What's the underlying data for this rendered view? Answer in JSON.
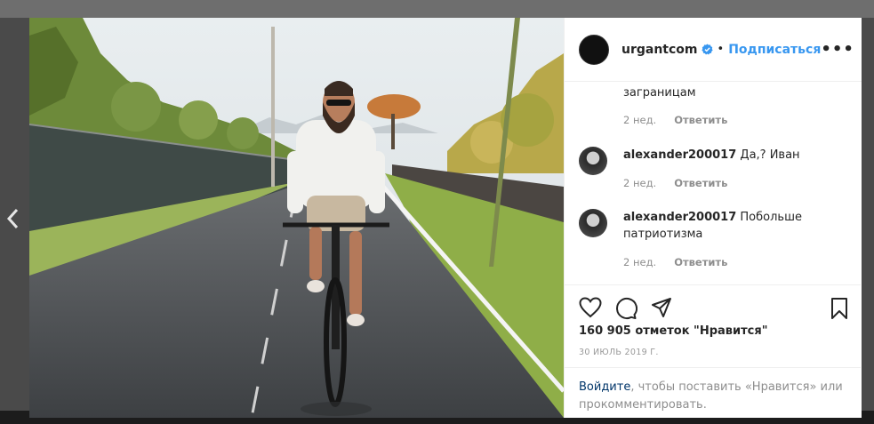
{
  "post": {
    "username": "urgantcom",
    "dot": "•",
    "follow_label": "Подписаться",
    "more_label": "•••"
  },
  "comments": [
    {
      "text": "заграницам",
      "time": "2 нед.",
      "reply": "Ответить"
    },
    {
      "username": "alexander200017",
      "text": "Да,? Иван",
      "time": "2 нед.",
      "reply": "Ответить"
    },
    {
      "username": "alexander200017",
      "text": "Побольше",
      "text_line2": "патриотизма",
      "time": "2 нед.",
      "reply": "Ответить"
    }
  ],
  "stats": {
    "likes": "160 905 отметок \"Нравится\"",
    "date": "30 ИЮЛЬ 2019 Г."
  },
  "login_prompt": {
    "link": "Войдите",
    "text": ", чтобы поставить «Нравится» или прокомментировать."
  },
  "colors": {
    "accent": "#3897f0",
    "link": "#003569",
    "muted": "#8e8e8e",
    "text": "#262626"
  }
}
